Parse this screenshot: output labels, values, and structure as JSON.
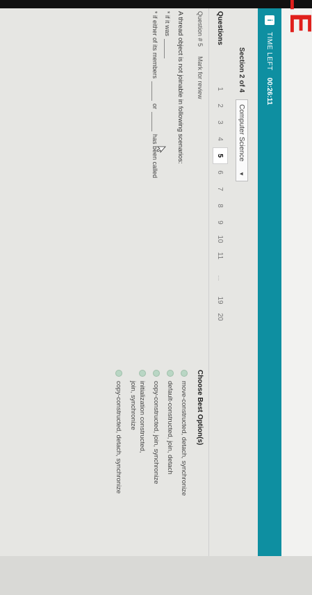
{
  "brand": {
    "logo_text": "ORACLE"
  },
  "timer": {
    "label": "TIME LEFT",
    "value": "00:26:11",
    "info_icon": "i"
  },
  "section": {
    "title": "Section 2 of 4",
    "selected_subject": "Computer Science"
  },
  "questions": {
    "label": "Questions",
    "numbers": [
      "1",
      "2",
      "3",
      "4",
      "5",
      "6",
      "7",
      "8",
      "9",
      "10",
      "11"
    ],
    "current": "5",
    "ellipsis": "...",
    "tail_numbers": [
      "19",
      "20"
    ]
  },
  "question": {
    "number_label": "Question # 5",
    "mark_link": "Mark for review",
    "text": "A thread object is not joinable in following scenarios:",
    "bullets": {
      "b1_prefix": "* if it was",
      "b2_prefix": "* if either of its members",
      "b2_or": "or",
      "b2_suffix": "has been called"
    }
  },
  "options": {
    "title": "Choose Best Option(s)",
    "items": [
      {
        "lines": [
          "move-constructed, detach, synchronize"
        ]
      },
      {
        "lines": [
          "default-constructed, join, detach"
        ]
      },
      {
        "lines": [
          "copy-constructed, join, synchronize"
        ]
      },
      {
        "lines": [
          "initialization constructed,",
          "join, synchronize"
        ]
      },
      {
        "lines": [
          "copy-constructed, detach, synchronize"
        ]
      }
    ]
  },
  "colors": {
    "header": "#0e8fa1",
    "logo": "#e0201c",
    "radio": "#b9d6c4"
  }
}
